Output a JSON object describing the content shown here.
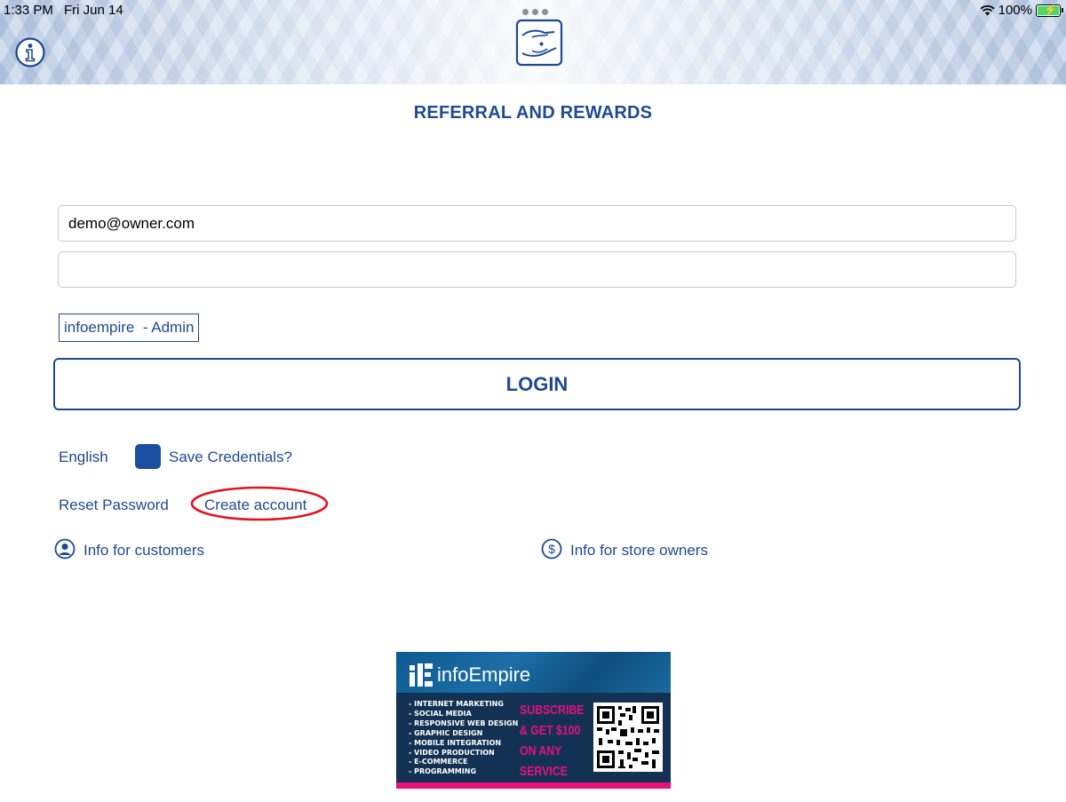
{
  "status_bar": {
    "time": "1:33 PM",
    "date": "Fri Jun 14",
    "battery": "100%"
  },
  "header": {
    "info_icon": "info-icon",
    "logo_icon": "hands-logo-icon"
  },
  "page": {
    "title": "REFERRAL AND REWARDS"
  },
  "form": {
    "email_value": "demo@owner.com",
    "password_value": "",
    "role_label": "infoempire  - Admin",
    "login_label": "LOGIN"
  },
  "options": {
    "language": "English",
    "save_credentials_label": "Save Credentials?",
    "save_credentials_checked": true,
    "reset_password": "Reset Password",
    "create_account": "Create account"
  },
  "info_links": {
    "customers": "Info for customers",
    "store_owners": "Info for store owners"
  },
  "ad": {
    "brand": "infoEmpire",
    "services": [
      "- INTERNET MARKETING",
      "- SOCIAL MEDIA",
      "- RESPONSIVE WEB DESIGN",
      "- GRAPHIC DESIGN",
      "- MOBILE INTEGRATION",
      "- VIDEO PRODUCTION",
      "- E-COMMERCE",
      "- PROGRAMMING"
    ],
    "promo": [
      "SUBSCRIBE",
      "& GET $100",
      "ON ANY",
      "SERVICE"
    ]
  },
  "colors": {
    "accent": "#1d4a93",
    "checkbox": "#1a4fa0",
    "highlight": "#e0141e",
    "ad_pink": "#e8107a"
  }
}
